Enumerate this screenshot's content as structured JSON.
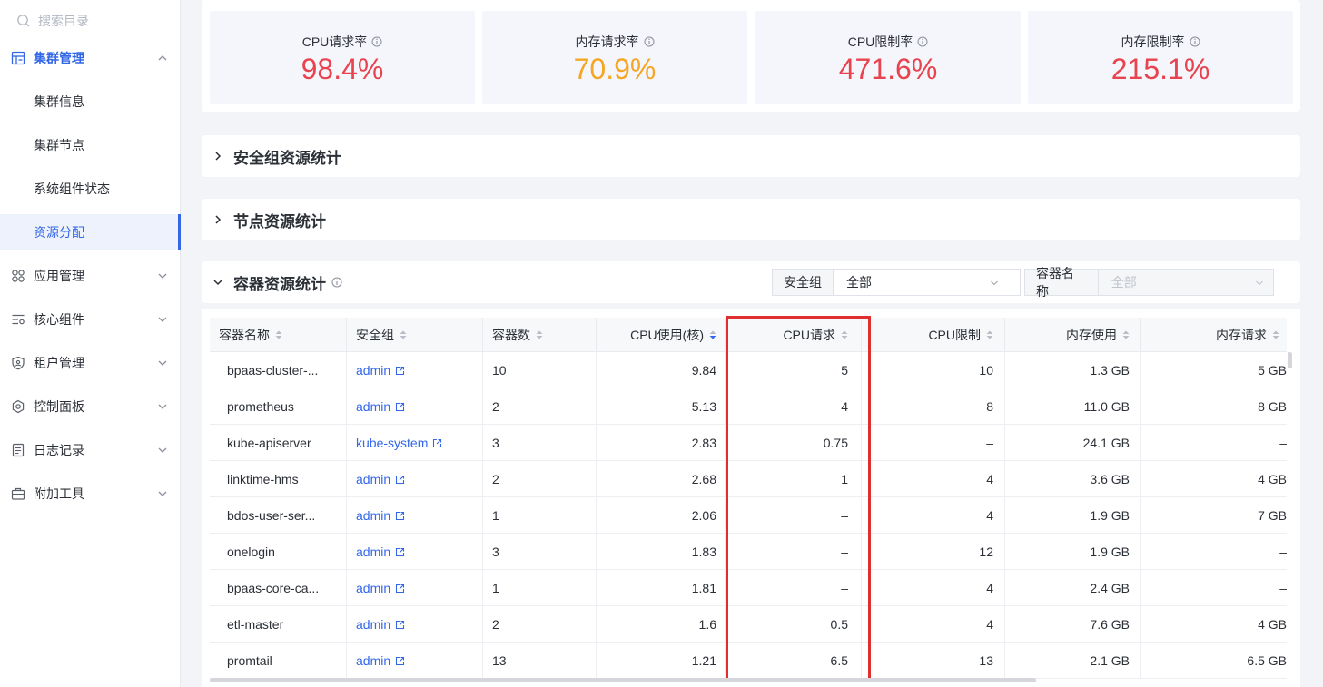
{
  "sidebar": {
    "search_placeholder": "搜索目录",
    "groups": [
      {
        "label": "集群管理",
        "icon": "cluster-icon"
      },
      {
        "label": "应用管理",
        "icon": "apps-icon"
      },
      {
        "label": "核心组件",
        "icon": "components-icon"
      },
      {
        "label": "租户管理",
        "icon": "tenant-shield-icon"
      },
      {
        "label": "控制面板",
        "icon": "settings-gear-icon"
      },
      {
        "label": "日志记录",
        "icon": "log-document-icon"
      },
      {
        "label": "附加工具",
        "icon": "toolbox-icon"
      }
    ],
    "sub_items": [
      {
        "label": "集群信息"
      },
      {
        "label": "集群节点"
      },
      {
        "label": "系统组件状态"
      },
      {
        "label": "资源分配"
      }
    ]
  },
  "stats": [
    {
      "label": "CPU请求率",
      "value": "98.4%",
      "color": "#e8434f"
    },
    {
      "label": "内存请求率",
      "value": "70.9%",
      "color": "#f5a623"
    },
    {
      "label": "CPU限制率",
      "value": "471.6%",
      "color": "#e8434f"
    },
    {
      "label": "内存限制率",
      "value": "215.1%",
      "color": "#e8434f"
    }
  ],
  "sections": {
    "security_group": "安全组资源统计",
    "node": "节点资源统计",
    "container": "容器资源统计"
  },
  "filters": {
    "security_group": {
      "label": "安全组",
      "value": "全部"
    },
    "container_name": {
      "label": "容器名称",
      "value": "全部"
    }
  },
  "table": {
    "columns": [
      "容器名称",
      "安全组",
      "容器数",
      "CPU使用(核)",
      "CPU请求",
      "CPU限制",
      "内存使用",
      "内存请求"
    ],
    "rows": [
      [
        "bpaas-cluster-...",
        "admin",
        "10",
        "9.84",
        "5",
        "10",
        "1.3 GB",
        "5 GB"
      ],
      [
        "prometheus",
        "admin",
        "2",
        "5.13",
        "4",
        "8",
        "11.0 GB",
        "8 GB"
      ],
      [
        "kube-apiserver",
        "kube-system",
        "3",
        "2.83",
        "0.75",
        "–",
        "24.1 GB",
        "–"
      ],
      [
        "linktime-hms",
        "admin",
        "2",
        "2.68",
        "1",
        "4",
        "3.6 GB",
        "4 GB"
      ],
      [
        "bdos-user-ser...",
        "admin",
        "1",
        "2.06",
        "–",
        "4",
        "1.9 GB",
        "7 GB"
      ],
      [
        "onelogin",
        "admin",
        "3",
        "1.83",
        "–",
        "12",
        "1.9 GB",
        "–"
      ],
      [
        "bpaas-core-ca...",
        "admin",
        "1",
        "1.81",
        "–",
        "4",
        "2.4 GB",
        "–"
      ],
      [
        "etl-master",
        "admin",
        "2",
        "1.6",
        "0.5",
        "4",
        "7.6 GB",
        "4 GB"
      ],
      [
        "promtail",
        "admin",
        "13",
        "1.21",
        "6.5",
        "13",
        "2.1 GB",
        "6.5 GB"
      ]
    ]
  },
  "colors": {
    "accent": "#3367e8",
    "highlight": "#e02f2f"
  }
}
